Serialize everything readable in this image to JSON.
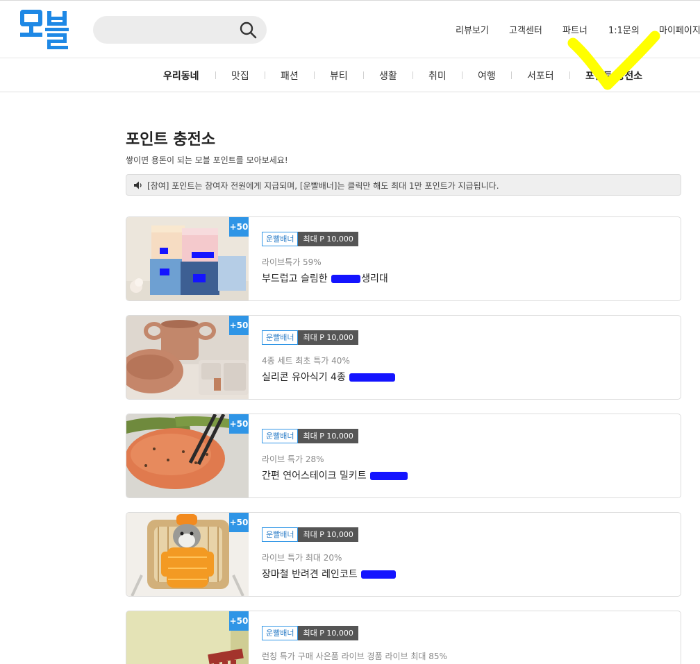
{
  "header": {
    "logo_text": "모블",
    "search": {
      "value": "",
      "placeholder": ""
    },
    "nav": [
      "리뷰보기",
      "고객센터",
      "파트너",
      "1:1문의",
      "마이페이지"
    ]
  },
  "categories": [
    "우리동네",
    "맛집",
    "패션",
    "뷰티",
    "생활",
    "취미",
    "여행",
    "서포터",
    "포인트 충전소"
  ],
  "page": {
    "title": "포인트 충전소",
    "subtitle": "쌓이면 용돈이 되는 모블 포인트를 모아보세요!",
    "notice": "[참여] 포인트는 참여자 전원에게 지급되며, [운빨배너]는 클릭만 해도 최대 1만 포인트가 지급됩니다."
  },
  "cards": [
    {
      "badge": "+50",
      "tag": "운빨배너",
      "max_label": "최대 P 10,000",
      "promo": "라이브특가 59%",
      "title_pre": "부드럽고 슬림한 ",
      "title_post": "생리대"
    },
    {
      "badge": "+50",
      "tag": "운빨배너",
      "max_label": "최대 P 10,000",
      "promo": "4종 세트 최초 특가 40%",
      "title_pre": "실리콘 유아식기 4종 ",
      "title_post": ""
    },
    {
      "badge": "+50",
      "tag": "운빨배너",
      "max_label": "최대 P 10,000",
      "promo": "라이브 특가 28%",
      "title_pre": "간편 연어스테이크 밀키트 ",
      "title_post": ""
    },
    {
      "badge": "+50",
      "tag": "운빨배너",
      "max_label": "최대 P 10,000",
      "promo": "라이브 특가 최대 20%",
      "title_pre": "장마철 반려견 레인코트 ",
      "title_post": ""
    },
    {
      "badge": "+50",
      "tag": "운빨배너",
      "max_label": "최대 P 10,000",
      "promo": "런칭 특가 구매 사은품 라이브 경품 라이브 최대 85%",
      "title_pre": "",
      "title_post": ""
    }
  ],
  "colors": {
    "accent": "#2f95e6",
    "logo": "#1e88e5",
    "tag_dark": "#555555",
    "highlight_annotation": "#ffff00",
    "redaction": "#1414ff"
  }
}
